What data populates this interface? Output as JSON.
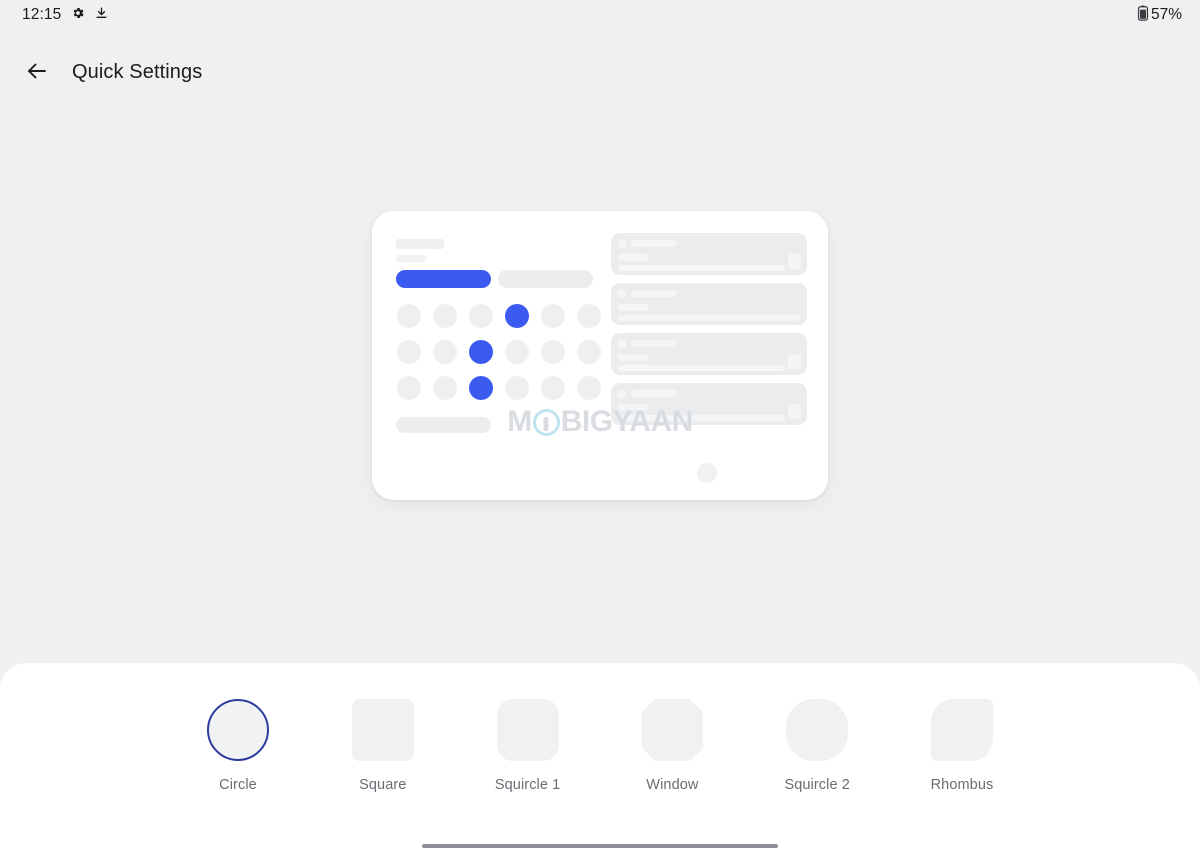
{
  "status_bar": {
    "clock": "12:15",
    "icons": [
      "gear-icon",
      "download-icon"
    ],
    "battery_percent": "57%",
    "battery_icon": "battery-icon"
  },
  "app_bar": {
    "back_icon": "arrow-left-icon",
    "title": "Quick Settings"
  },
  "preview": {
    "watermark": {
      "prefix": "M",
      "logo": "mobigyaan-logo-icon",
      "suffix": "BIGYAAN"
    },
    "accent_color": "#3b5bf0",
    "placeholder_color": "#ebedef",
    "toggle_grid": {
      "columns": 6,
      "rows": 3,
      "active_cells": [
        3,
        8,
        14
      ]
    },
    "notification_count": 4
  },
  "shape_picker": {
    "selected": "Circle",
    "selected_ring_color": "#2e3b9e",
    "options": [
      {
        "label": "Circle",
        "shape": "circle"
      },
      {
        "label": "Square",
        "shape": "square"
      },
      {
        "label": "Squircle 1",
        "shape": "squircle1"
      },
      {
        "label": "Window",
        "shape": "window"
      },
      {
        "label": "Squircle 2",
        "shape": "squircle2"
      },
      {
        "label": "Rhombus",
        "shape": "rhombus"
      }
    ]
  },
  "navigation_bar": {
    "gesture_pill": "home-gesture-pill"
  }
}
